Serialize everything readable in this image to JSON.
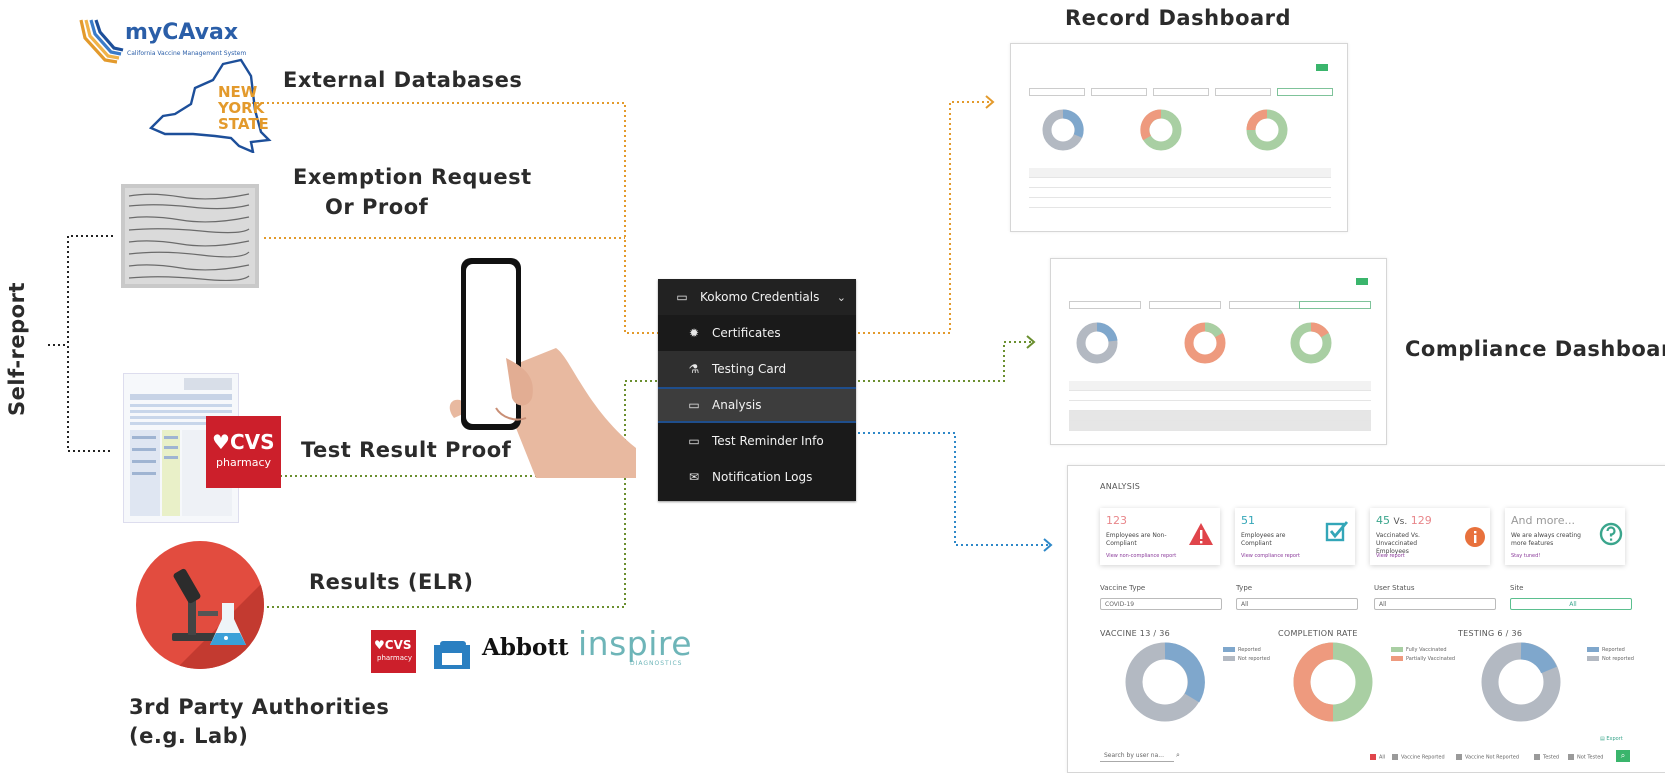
{
  "labels": {
    "record_dashboard": "Record Dashboard",
    "external_databases": "External Databases",
    "exemption_line1": "Exemption Request",
    "exemption_line2": "Or Proof",
    "self_report": "Self-report",
    "test_result_proof": "Test Result Proof",
    "results_elr": "Results (ELR)",
    "third_party_line1": "3rd Party Authorities",
    "third_party_line2": "(e.g. Lab)",
    "compliance_dashboard": "Compliance Dashboard"
  },
  "logos": {
    "mycavax_title": "myCAvax",
    "mycavax_subtitle": "California Vaccine Management System",
    "new_york_state": [
      "NEW",
      "YORK",
      "STATE"
    ],
    "cvs": "CVS",
    "cvs_sub": "pharmacy",
    "abbott": "Abbott",
    "inspire": "inspire",
    "inspire_sub": "DIAGNOSTICS"
  },
  "menu": {
    "header": "Kokomo Credentials",
    "items": [
      {
        "label": "Certificates",
        "icon": "badge-icon"
      },
      {
        "label": "Testing Card",
        "icon": "flask-icon"
      },
      {
        "label": "Analysis",
        "icon": "monitor-icon",
        "active": true
      },
      {
        "label": "Test Reminder Info",
        "icon": "monitor-icon"
      },
      {
        "label": "Notification Logs",
        "icon": "mail-icon"
      }
    ]
  },
  "colors": {
    "orange": "#e39a2c",
    "green": "#6a8f2f",
    "blue": "#2e88c8",
    "black": "#222222",
    "donut_blue": "#7fa7cc",
    "donut_grey": "#b3b9c2",
    "donut_orange": "#ee9a7e",
    "donut_green": "#a9cfa3"
  },
  "analysis": {
    "title": "ANALYSIS",
    "cards": [
      {
        "num": "123",
        "desc": "Employees are Non-Compliant",
        "link": "View non-compliance report",
        "num_color": "#e8868a",
        "icon": "warning-icon"
      },
      {
        "num": "51",
        "desc": "Employees are Compliant",
        "link": "View compliance report",
        "num_color": "#33a6b8",
        "icon": "checkbox-icon"
      },
      {
        "num_a": "45",
        "vs": "Vs.",
        "num_b": "129",
        "desc": "Vaccinated Vs. Unvaccinated Employees",
        "link": "View report",
        "icon": "info-icon"
      },
      {
        "num": "And more...",
        "desc": "We are always creating more features",
        "link": "Stay tuned!",
        "num_color": "#999999",
        "icon": "question-icon"
      }
    ],
    "filters": [
      {
        "label": "Vaccine Type",
        "value": "COVID-19"
      },
      {
        "label": "Type",
        "value": "All"
      },
      {
        "label": "User Status",
        "value": "All"
      },
      {
        "label": "Site",
        "value": "All"
      }
    ],
    "charts": [
      {
        "title": "VACCINE 13 / 36",
        "legend": [
          "Reported",
          "Not reported"
        ]
      },
      {
        "title": "COMPLETION RATE",
        "legend": [
          "Fully Vaccinated",
          "Partially Vaccinated"
        ]
      },
      {
        "title": "TESTING 6 / 36",
        "legend": [
          "Reported",
          "Not reported"
        ]
      }
    ],
    "export": "Export",
    "search_placeholder": "Search by user na...",
    "checks": [
      "All",
      "Vaccine Reported",
      "Vaccine Not Reported",
      "Tested",
      "Not Tested"
    ]
  }
}
